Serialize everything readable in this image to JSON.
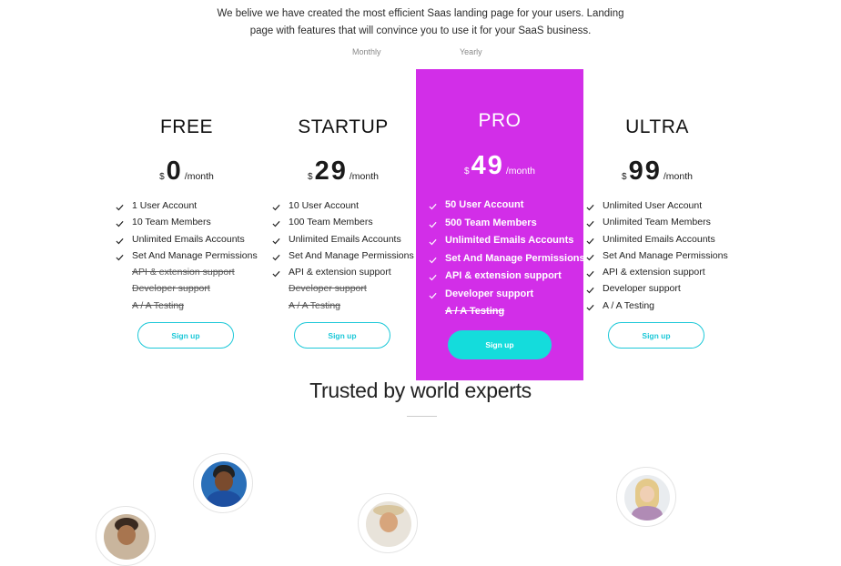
{
  "intro": {
    "line1": "We belive we have created the most efficient Saas landing page for your users. Landing",
    "line2": "page with features that will convince you to use it for your SaaS business."
  },
  "billing_toggle": {
    "monthly": "Monthly",
    "yearly": "Yearly"
  },
  "plans": [
    {
      "name": "FREE",
      "currency": "$",
      "price": "0",
      "period": "/month",
      "features": [
        {
          "text": "1 User Account",
          "included": true
        },
        {
          "text": "10 Team Members",
          "included": true
        },
        {
          "text": "Unlimited Emails Accounts",
          "included": true
        },
        {
          "text": "Set And Manage Permissions",
          "included": true
        },
        {
          "text": "API & extension support",
          "included": false
        },
        {
          "text": "Developer support",
          "included": false
        },
        {
          "text": "A / A Testing",
          "included": false
        }
      ],
      "cta": "Sign up"
    },
    {
      "name": "STARTUP",
      "currency": "$",
      "price": "29",
      "period": "/month",
      "features": [
        {
          "text": "10 User Account",
          "included": true
        },
        {
          "text": "100 Team Members",
          "included": true
        },
        {
          "text": "Unlimited Emails Accounts",
          "included": true
        },
        {
          "text": "Set And Manage Permissions",
          "included": true
        },
        {
          "text": "API & extension support",
          "included": true
        },
        {
          "text": "Developer support",
          "included": false
        },
        {
          "text": "A / A Testing",
          "included": false
        }
      ],
      "cta": "Sign up"
    },
    {
      "name": "PRO",
      "currency": "$",
      "price": "49",
      "period": "/month",
      "features": [
        {
          "text": "50 User Account",
          "included": true
        },
        {
          "text": "500 Team Members",
          "included": true
        },
        {
          "text": "Unlimited Emails Accounts",
          "included": true
        },
        {
          "text": "Set And Manage Permissions",
          "included": true
        },
        {
          "text": "API & extension support",
          "included": true
        },
        {
          "text": "Developer support",
          "included": true
        },
        {
          "text": "A / A Testing",
          "included": false
        }
      ],
      "cta": "Sign up"
    },
    {
      "name": "ULTRA",
      "currency": "$",
      "price": "99",
      "period": "/month",
      "features": [
        {
          "text": "Unlimited User Account",
          "included": true
        },
        {
          "text": "Unlimited Team Members",
          "included": true
        },
        {
          "text": "Unlimited Emails Accounts",
          "included": true
        },
        {
          "text": "Set And Manage Permissions",
          "included": true
        },
        {
          "text": "API & extension support",
          "included": true
        },
        {
          "text": "Developer support",
          "included": true
        },
        {
          "text": "A / A Testing",
          "included": true
        }
      ],
      "cta": "Sign up"
    }
  ],
  "trusted": {
    "title": "Trusted by world experts"
  },
  "colors": {
    "pro_background": "#d22ee8",
    "accent": "#1cc8d8",
    "pro_cta": "#14dcdc"
  },
  "icons": {
    "feature_check": "check-icon"
  }
}
